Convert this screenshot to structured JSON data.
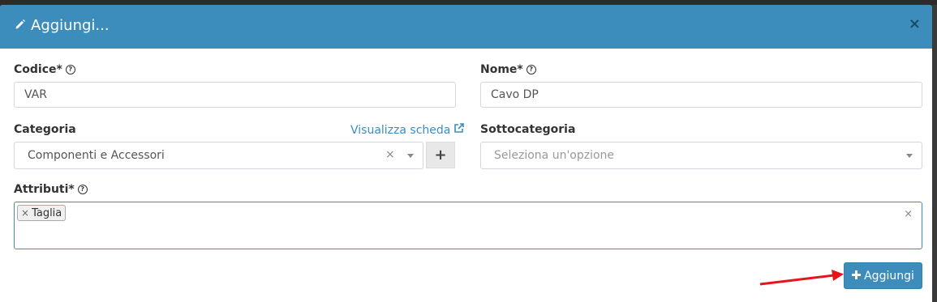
{
  "modal": {
    "title": "Aggiungi...",
    "close_label": "×"
  },
  "form": {
    "codice": {
      "label": "Codice*",
      "value": "VAR"
    },
    "nome": {
      "label": "Nome*",
      "value": "Cavo DP"
    },
    "categoria": {
      "label": "Categoria",
      "link": "Visualizza scheda",
      "value": "Componenti e Accessori",
      "clear": "×",
      "add_label": "+"
    },
    "sottocategoria": {
      "label": "Sottocategoria",
      "placeholder": "Seleziona un'opzione"
    },
    "attributi": {
      "label": "Attributi*",
      "tags": [
        "Taglia"
      ],
      "tag_remove": "×",
      "clear": "×"
    }
  },
  "footer": {
    "submit_label": "Aggiungi"
  },
  "colors": {
    "header": "#3c8dbc",
    "annotation_arrow": "#e8141c"
  },
  "icons": {
    "title": "pencil-icon",
    "help": "question-circle-icon",
    "link": "external-link-icon",
    "submit": "plus-icon"
  }
}
